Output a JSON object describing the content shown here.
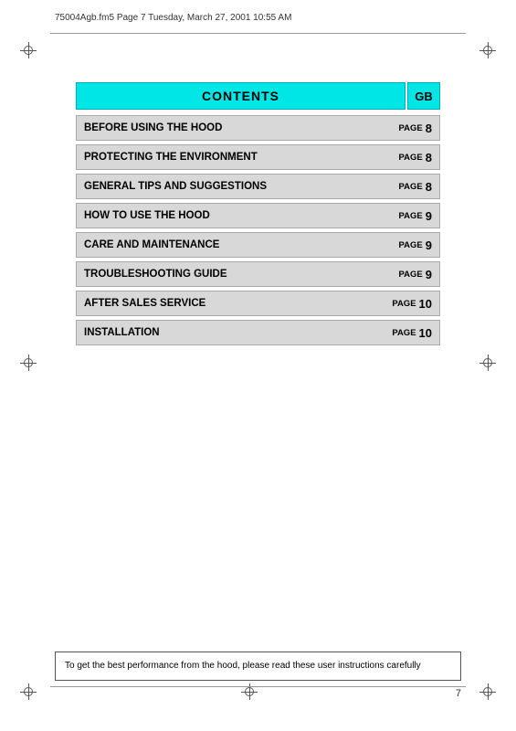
{
  "header": {
    "filename": "75004Agb.fm5  Page 7  Tuesday, March 27, 2001  10:55 AM"
  },
  "contents": {
    "title": "CONTENTS",
    "gb_label": "GB",
    "rows": [
      {
        "title": "BEFORE USING THE HOOD",
        "page_label": "PAGE",
        "page_num": "8"
      },
      {
        "title": "PROTECTING THE ENVIRONMENT",
        "page_label": "PAGE",
        "page_num": "8"
      },
      {
        "title": "GENERAL TIPS AND SUGGESTIONS",
        "page_label": "PAGE",
        "page_num": "8"
      },
      {
        "title": "HOW TO USE THE HOOD",
        "page_label": "PAGE",
        "page_num": "9"
      },
      {
        "title": "CARE AND MAINTENANCE",
        "page_label": "PAGE",
        "page_num": "9"
      },
      {
        "title": "TROUBLESHOOTING GUIDE",
        "page_label": "PAGE",
        "page_num": "9"
      },
      {
        "title": "AFTER SALES SERVICE",
        "page_label": "PAGE",
        "page_num": "10"
      },
      {
        "title": "INSTALLATION",
        "page_label": "PAGE",
        "page_num": "10"
      }
    ]
  },
  "footer": {
    "note": "To get the best performance from the hood, please read these user instructions carefully",
    "page_number": "7"
  }
}
